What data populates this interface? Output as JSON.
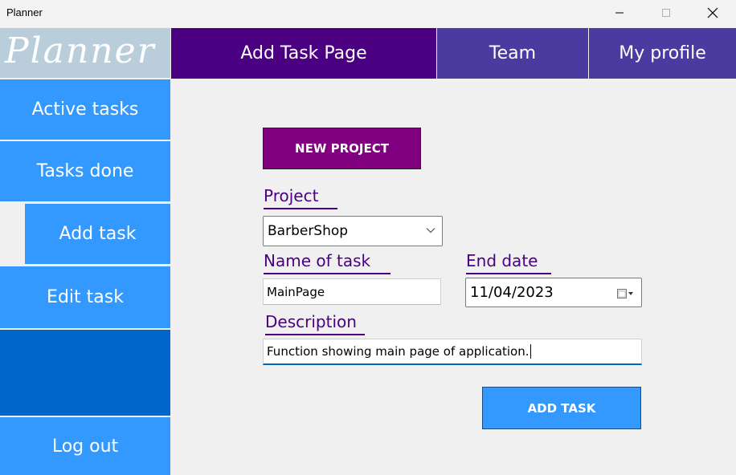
{
  "window": {
    "title": "Planner",
    "controls": {
      "minimize": "minimize-icon",
      "maximize": "maximize-icon",
      "close": "close-icon"
    }
  },
  "logo": "Planner",
  "topnav": {
    "add_task_page": "Add Task Page",
    "team": "Team",
    "my_profile": "My profile"
  },
  "sidebar": {
    "items": [
      {
        "label": "Active tasks"
      },
      {
        "label": "Tasks done"
      },
      {
        "label": "Add task"
      },
      {
        "label": "Edit task"
      },
      {
        "label": "Log out"
      }
    ]
  },
  "form": {
    "new_project_button": "NEW PROJECT",
    "project_label": "Project",
    "project_value": "BarberShop",
    "name_label": "Name of task",
    "name_value": "MainPage",
    "end_date_label": "End date",
    "end_date_value": "11/04/2023",
    "description_label": "Description",
    "description_value": "Function showing main page of application.",
    "add_task_button": "ADD TASK"
  },
  "colors": {
    "nav_active": "#4b0082",
    "nav_inactive": "#4b3aa0",
    "sidebar": "#3399ff",
    "sidebar_dark": "#0066cc",
    "new_project": "#800080",
    "label": "#4b0082"
  }
}
